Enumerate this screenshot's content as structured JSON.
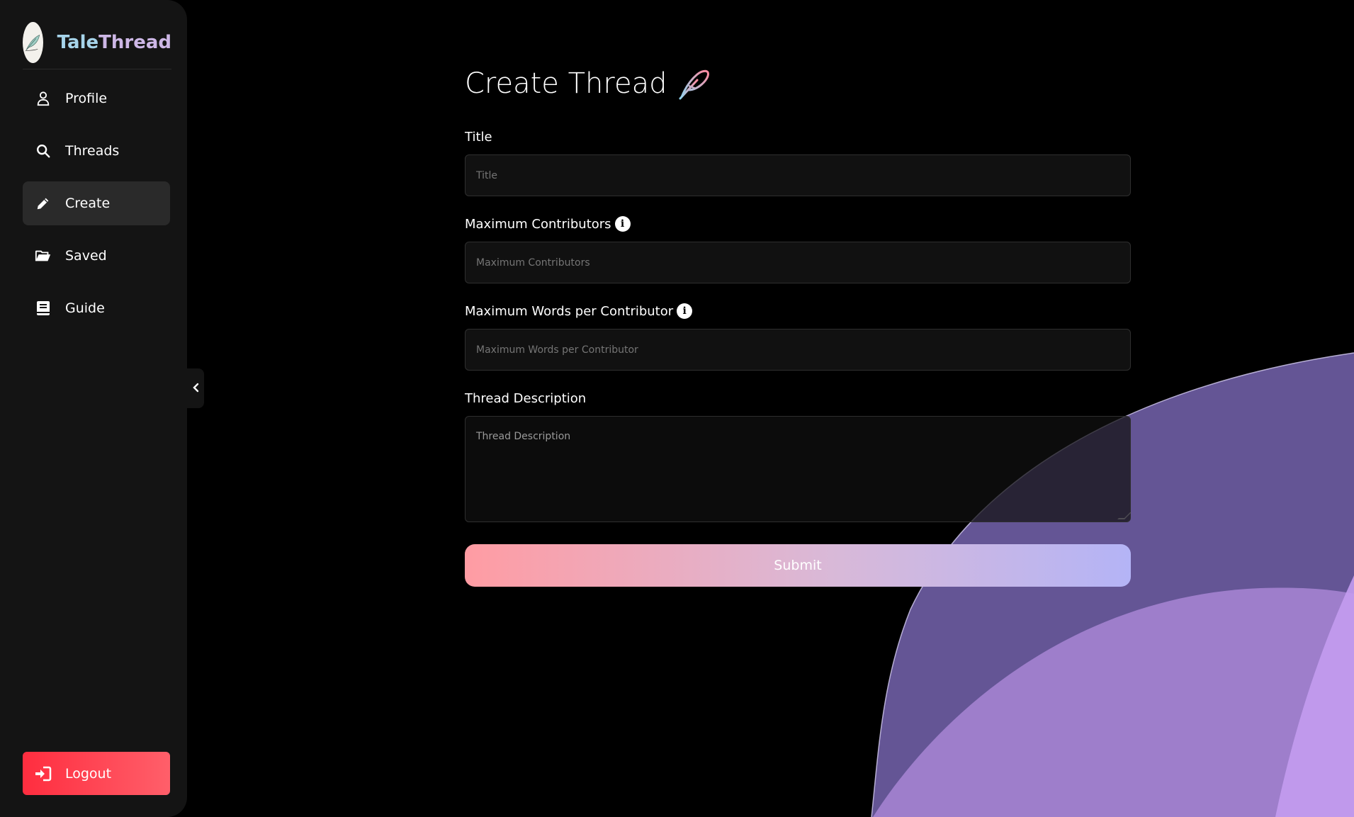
{
  "app": {
    "brand_part1": "Tale",
    "brand_part2": "Thread",
    "logo_icon": "feather-quill-logo"
  },
  "sidebar": {
    "items": [
      {
        "label": "Profile",
        "icon": "user-icon",
        "active": false
      },
      {
        "label": "Threads",
        "icon": "search-icon",
        "active": false
      },
      {
        "label": "Create",
        "icon": "pencil-icon",
        "active": true
      },
      {
        "label": "Saved",
        "icon": "folder-open-icon",
        "active": false
      },
      {
        "label": "Guide",
        "icon": "book-icon",
        "active": false
      }
    ],
    "logout_label": "Logout",
    "collapse_icon": "chevron-left-icon"
  },
  "form": {
    "title": "Create Thread",
    "title_icon": "feather-icon",
    "fields": {
      "title": {
        "label": "Title",
        "placeholder": "Title"
      },
      "max_contributors": {
        "label": "Maximum Contributors",
        "placeholder": "Maximum Contributors",
        "info_icon": "info-icon"
      },
      "max_words": {
        "label": "Maximum Words per Contributor",
        "placeholder": "Maximum Words per Contributor",
        "info_icon": "info-icon"
      },
      "description": {
        "label": "Thread Description",
        "placeholder": "Thread Description"
      }
    },
    "submit_label": "Submit"
  },
  "colors": {
    "sidebar_bg": "#141414",
    "logout_gradient": [
      "#ff2d3f",
      "#ff5f6a"
    ],
    "submit_gradient": [
      "#ff9ca3",
      "#b4b4f6"
    ],
    "brand_tale": "#a6d4ea",
    "brand_thread": "#cdb7e6"
  }
}
